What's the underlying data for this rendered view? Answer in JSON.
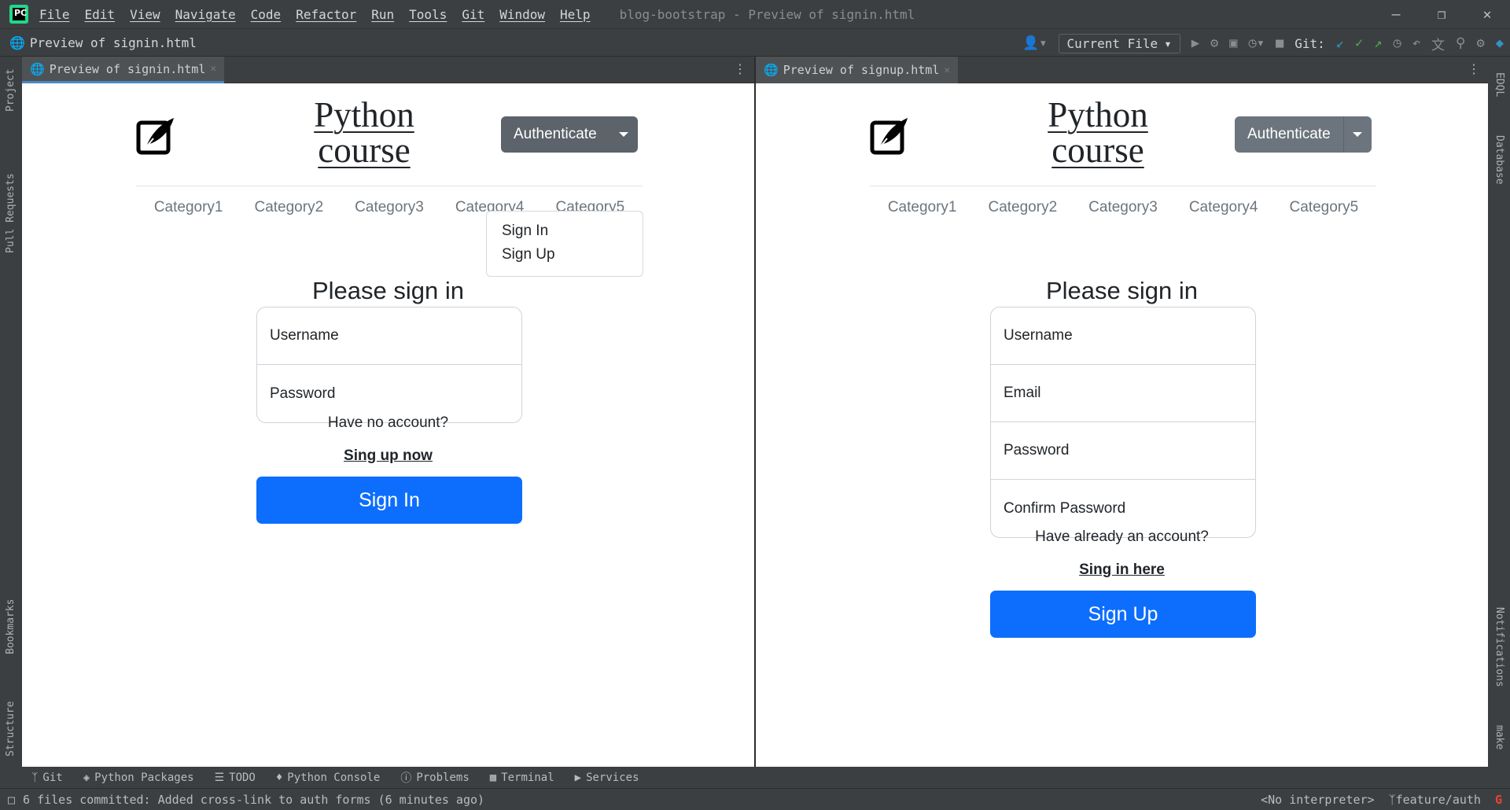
{
  "ide": {
    "menu": [
      "File",
      "Edit",
      "View",
      "Navigate",
      "Code",
      "Refactor",
      "Run",
      "Tools",
      "Git",
      "Window",
      "Help"
    ],
    "window_title": "blog-bootstrap - Preview of signin.html",
    "breadcrumb": "Preview of signin.html",
    "run_config": "Current File",
    "git_label": "Git:",
    "left_tools": [
      "Project",
      "Pull Requests",
      "Bookmarks",
      "Structure"
    ],
    "right_tools": [
      "EDQL",
      "Database",
      "Notifications",
      "make"
    ],
    "bottom_tools": [
      "Git",
      "Python Packages",
      "TODO",
      "Python Console",
      "Problems",
      "Terminal",
      "Services"
    ],
    "status_message": "6 files committed: Added cross-link to auth forms (6 minutes ago)",
    "interpreter": "<No interpreter>",
    "branch": "feature/auth"
  },
  "left_pane": {
    "tab_title": "Preview of signin.html",
    "brand_line1": "Python",
    "brand_line2": "course",
    "auth_label": "Authenticate",
    "dropdown": [
      "Sign In",
      "Sign Up"
    ],
    "nav": [
      "Category1",
      "Category2",
      "Category3",
      "Category4",
      "Category5"
    ],
    "form_title": "Please sign in",
    "fields": [
      "Username",
      "Password"
    ],
    "helper": "Have no account?",
    "link": "Sing up now",
    "submit": "Sign In"
  },
  "right_pane": {
    "tab_title": "Preview of signup.html",
    "brand_line1": "Python",
    "brand_line2": "course",
    "auth_label": "Authenticate",
    "nav": [
      "Category1",
      "Category2",
      "Category3",
      "Category4",
      "Category5"
    ],
    "form_title": "Please sign in",
    "fields": [
      "Username",
      "Email",
      "Password",
      "Confirm Password"
    ],
    "helper": "Have already an account?",
    "link": "Sing in here",
    "submit": "Sign Up"
  }
}
